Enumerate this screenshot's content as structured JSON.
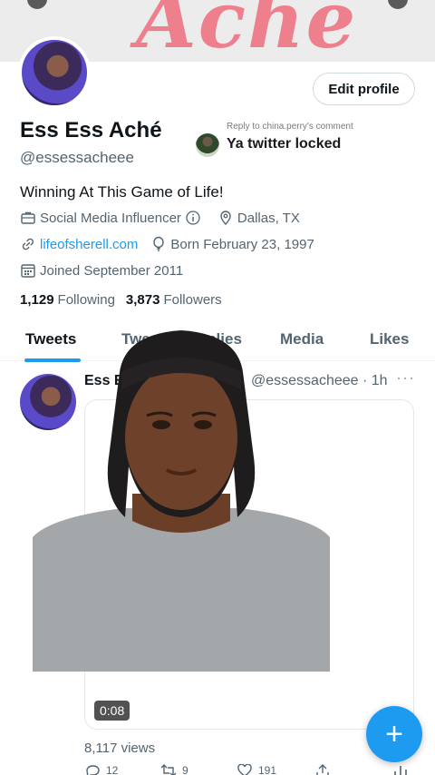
{
  "banner": {
    "text": "Aché"
  },
  "profile": {
    "edit_label": "Edit profile",
    "display_name": "Ess Ess Aché",
    "handle": "@essessacheee",
    "bio": "Winning At This Game of Life!",
    "category": "Social Media Influencer",
    "location": "Dallas, TX",
    "website": "lifeofsherell.com",
    "birthday": "Born February 23, 1997",
    "joined": "Joined September 2011",
    "following_count": "1,129",
    "following_label": "Following",
    "followers_count": "3,873",
    "followers_label": "Followers"
  },
  "reply_overlay": {
    "note": "Reply to china.perry's comment",
    "text": "Ya twitter locked"
  },
  "tabs": [
    {
      "label": "Tweets",
      "active": true
    },
    {
      "label": "Tweets & replies",
      "active": false
    },
    {
      "label": "Media",
      "active": false
    },
    {
      "label": "Likes",
      "active": false
    }
  ],
  "tweet": {
    "name": "Ess Ess Aché",
    "handle_time": "@essessacheee · 1h",
    "more": "···",
    "video_duration": "0:08",
    "views": "8,117 views",
    "replies": "12",
    "retweets": "9",
    "likes": "191"
  },
  "fab": {
    "icon": "plus-icon",
    "symbol": "+"
  },
  "colors": {
    "accent": "#1d9bf0",
    "banner_text": "#ee7f8d"
  }
}
